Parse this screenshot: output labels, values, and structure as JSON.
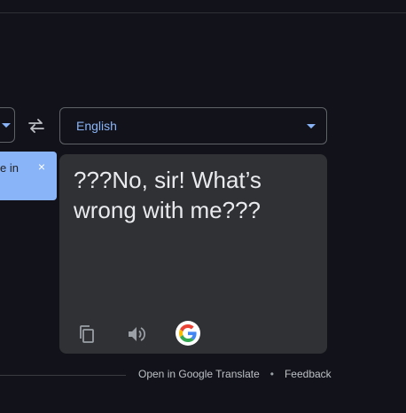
{
  "source": {
    "caret_color": "#8ab4f8"
  },
  "swap": {
    "icon": "swap-horiz-icon"
  },
  "target": {
    "language": "English"
  },
  "banner": {
    "text": "e in",
    "close_glyph": "×",
    "color": "#8ab4f8"
  },
  "result": {
    "text": "???No, sir! What’s wrong with me???",
    "actions": {
      "copy_icon": "copy-icon",
      "speak_icon": "volume-icon",
      "logo": "google-logo"
    }
  },
  "footer": {
    "open_link": "Open in Google Translate",
    "separator": "•",
    "feedback_link": "Feedback"
  },
  "colors": {
    "background": "#12131a",
    "card": "#303134",
    "accent": "#8ab4f8",
    "text": "#e8eaed"
  }
}
